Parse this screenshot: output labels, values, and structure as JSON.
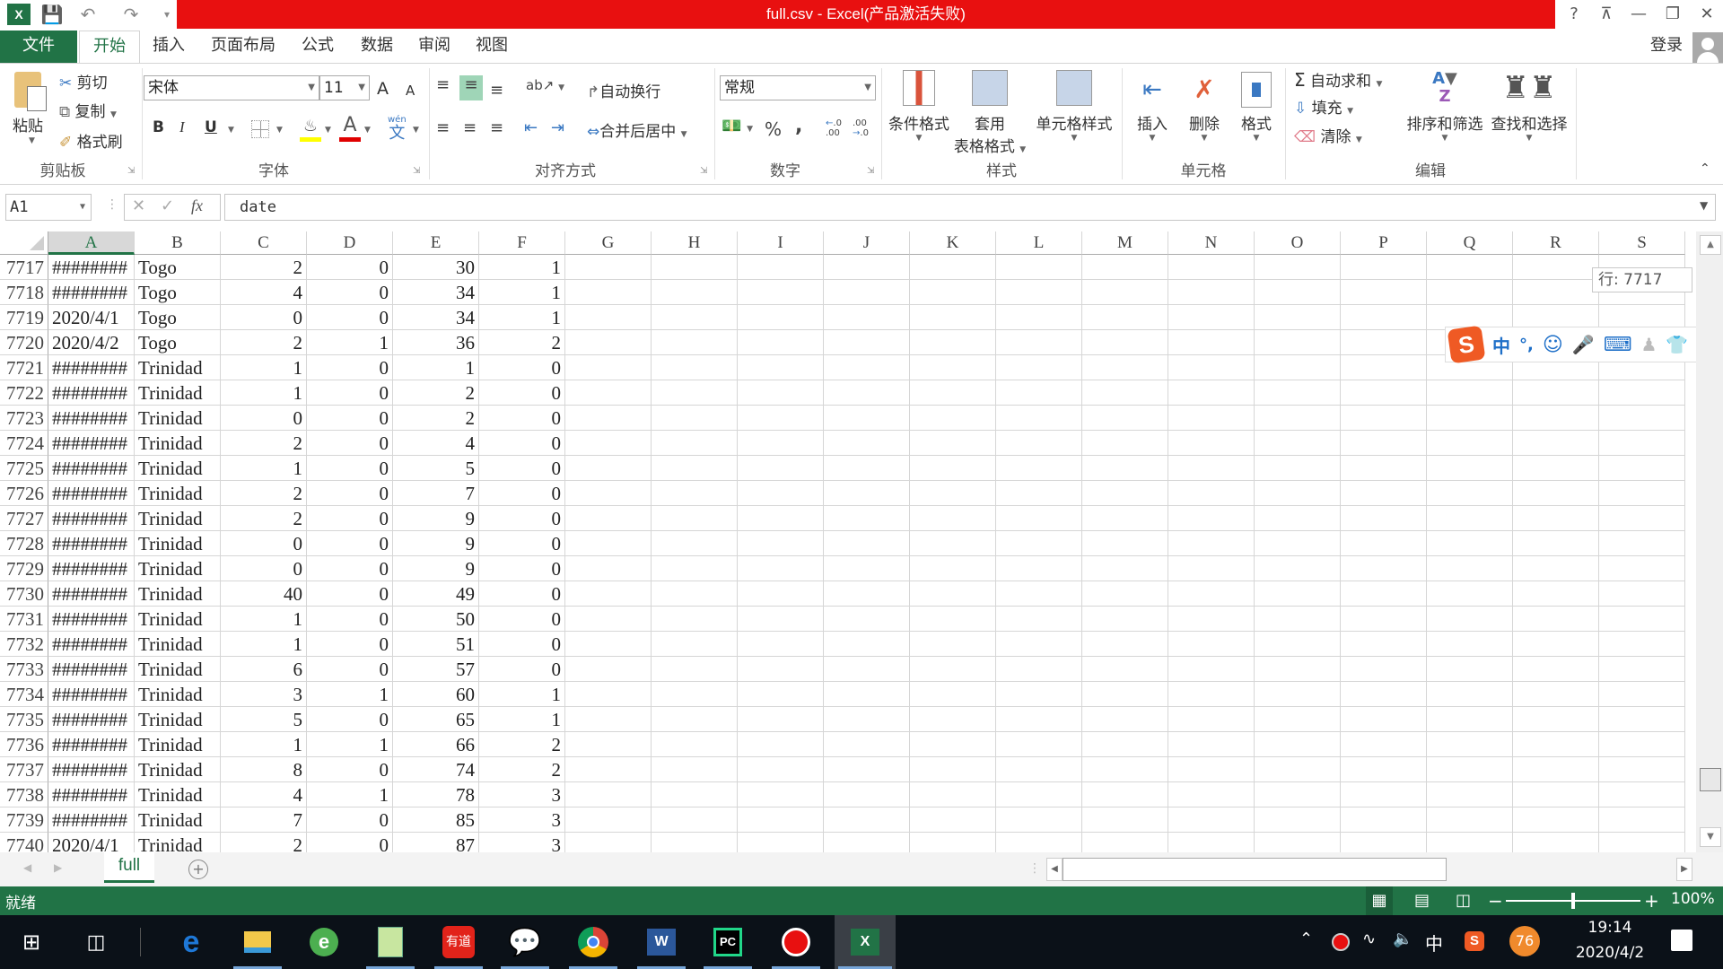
{
  "app": {
    "title": "full.csv -  Excel(产品激活失败)",
    "quick_access": [
      "excel-logo",
      "save",
      "undo",
      "redo",
      "customize"
    ],
    "window_buttons": {
      "help": "?",
      "ribbon_display": "⊼",
      "minimize": "—",
      "restore": "❐",
      "close": "✕"
    },
    "sign_in": "登录"
  },
  "menu_tabs": [
    {
      "label": "文件"
    },
    {
      "label": "开始"
    },
    {
      "label": "插入"
    },
    {
      "label": "页面布局"
    },
    {
      "label": "公式"
    },
    {
      "label": "数据"
    },
    {
      "label": "审阅"
    },
    {
      "label": "视图"
    }
  ],
  "ribbon": {
    "clipboard": {
      "label": "剪贴板",
      "paste": "粘贴",
      "cut": "剪切",
      "copy": "复制",
      "format_painter": "格式刷"
    },
    "font": {
      "label": "字体",
      "font_name": "宋体",
      "font_size": "11",
      "bold": "B",
      "italic": "I",
      "underline": "U",
      "grow": "A",
      "shrink": "A",
      "fill_color": "#ffff00",
      "font_color": "#e00000",
      "phonetic": "wén"
    },
    "alignment": {
      "label": "对齐方式",
      "wrap_text": "自动换行",
      "merge_center": "合并后居中"
    },
    "number": {
      "label": "数字",
      "format": "常规",
      "percent": "%",
      "comma": ",",
      "inc_decimal": ".00",
      "dec_decimal": ".0"
    },
    "styles": {
      "label": "样式",
      "conditional": "条件格式",
      "table_format_1": "套用",
      "table_format_2": "表格格式",
      "cell_styles": "单元格样式"
    },
    "cells": {
      "label": "单元格",
      "insert": "插入",
      "delete": "删除",
      "format": "格式"
    },
    "editing": {
      "label": "编辑",
      "autosum": "自动求和",
      "fill": "填充",
      "clear": "清除",
      "sort_filter": "排序和筛选",
      "find_select": "查找和选择"
    }
  },
  "formula_bar": {
    "name_box": "A1",
    "cancel": "✕",
    "enter": "✓",
    "fx": "fx",
    "content": "date"
  },
  "columns": [
    "A",
    "B",
    "C",
    "D",
    "E",
    "F",
    "G",
    "H",
    "I",
    "J",
    "K",
    "L",
    "M",
    "N",
    "O",
    "P",
    "Q",
    "R",
    "S"
  ],
  "selected_column": "A",
  "rows": [
    {
      "n": "7717",
      "a": "########",
      "b": "Togo",
      "c": "2",
      "d": "0",
      "e": "30",
      "f": "1"
    },
    {
      "n": "7718",
      "a": "########",
      "b": "Togo",
      "c": "4",
      "d": "0",
      "e": "34",
      "f": "1"
    },
    {
      "n": "7719",
      "a": "2020/4/1",
      "b": "Togo",
      "c": "0",
      "d": "0",
      "e": "34",
      "f": "1"
    },
    {
      "n": "7720",
      "a": "2020/4/2",
      "b": "Togo",
      "c": "2",
      "d": "1",
      "e": "36",
      "f": "2"
    },
    {
      "n": "7721",
      "a": "########",
      "b": "Trinidad",
      "c": "1",
      "d": "0",
      "e": "1",
      "f": "0"
    },
    {
      "n": "7722",
      "a": "########",
      "b": "Trinidad",
      "c": "1",
      "d": "0",
      "e": "2",
      "f": "0"
    },
    {
      "n": "7723",
      "a": "########",
      "b": "Trinidad",
      "c": "0",
      "d": "0",
      "e": "2",
      "f": "0"
    },
    {
      "n": "7724",
      "a": "########",
      "b": "Trinidad",
      "c": "2",
      "d": "0",
      "e": "4",
      "f": "0"
    },
    {
      "n": "7725",
      "a": "########",
      "b": "Trinidad",
      "c": "1",
      "d": "0",
      "e": "5",
      "f": "0"
    },
    {
      "n": "7726",
      "a": "########",
      "b": "Trinidad",
      "c": "2",
      "d": "0",
      "e": "7",
      "f": "0"
    },
    {
      "n": "7727",
      "a": "########",
      "b": "Trinidad",
      "c": "2",
      "d": "0",
      "e": "9",
      "f": "0"
    },
    {
      "n": "7728",
      "a": "########",
      "b": "Trinidad",
      "c": "0",
      "d": "0",
      "e": "9",
      "f": "0"
    },
    {
      "n": "7729",
      "a": "########",
      "b": "Trinidad",
      "c": "0",
      "d": "0",
      "e": "9",
      "f": "0"
    },
    {
      "n": "7730",
      "a": "########",
      "b": "Trinidad",
      "c": "40",
      "d": "0",
      "e": "49",
      "f": "0"
    },
    {
      "n": "7731",
      "a": "########",
      "b": "Trinidad",
      "c": "1",
      "d": "0",
      "e": "50",
      "f": "0"
    },
    {
      "n": "7732",
      "a": "########",
      "b": "Trinidad",
      "c": "1",
      "d": "0",
      "e": "51",
      "f": "0"
    },
    {
      "n": "7733",
      "a": "########",
      "b": "Trinidad",
      "c": "6",
      "d": "0",
      "e": "57",
      "f": "0"
    },
    {
      "n": "7734",
      "a": "########",
      "b": "Trinidad",
      "c": "3",
      "d": "1",
      "e": "60",
      "f": "1"
    },
    {
      "n": "7735",
      "a": "########",
      "b": "Trinidad",
      "c": "5",
      "d": "0",
      "e": "65",
      "f": "1"
    },
    {
      "n": "7736",
      "a": "########",
      "b": "Trinidad",
      "c": "1",
      "d": "1",
      "e": "66",
      "f": "2"
    },
    {
      "n": "7737",
      "a": "########",
      "b": "Trinidad",
      "c": "8",
      "d": "0",
      "e": "74",
      "f": "2"
    },
    {
      "n": "7738",
      "a": "########",
      "b": "Trinidad",
      "c": "4",
      "d": "1",
      "e": "78",
      "f": "3"
    },
    {
      "n": "7739",
      "a": "########",
      "b": "Trinidad",
      "c": "7",
      "d": "0",
      "e": "85",
      "f": "3"
    },
    {
      "n": "7740",
      "a": "2020/4/1",
      "b": "Trinidad",
      "c": "2",
      "d": "0",
      "e": "87",
      "f": "3"
    }
  ],
  "row_tooltip": "行: 7717",
  "ime_toolbar": {
    "mode": "中",
    "punct": "°,"
  },
  "sheets": [
    {
      "name": "full",
      "active": true
    }
  ],
  "status": {
    "text": "就绪",
    "zoom": "100%",
    "zoom_level": 1.0
  },
  "taskbar": {
    "apps": [
      "edge",
      "file-explorer",
      "360-browser",
      "notepad-plus",
      "youdao",
      "wechat",
      "chrome",
      "word",
      "pycharm",
      "recorder",
      "excel"
    ],
    "youdao_label": "有道",
    "tray": {
      "ime": "中",
      "badge": "76",
      "time": "19:14",
      "date": "2020/4/2"
    }
  },
  "colors": {
    "excel_green": "#217346",
    "title_red": "#e81010",
    "taskbar": "#0b1118"
  }
}
